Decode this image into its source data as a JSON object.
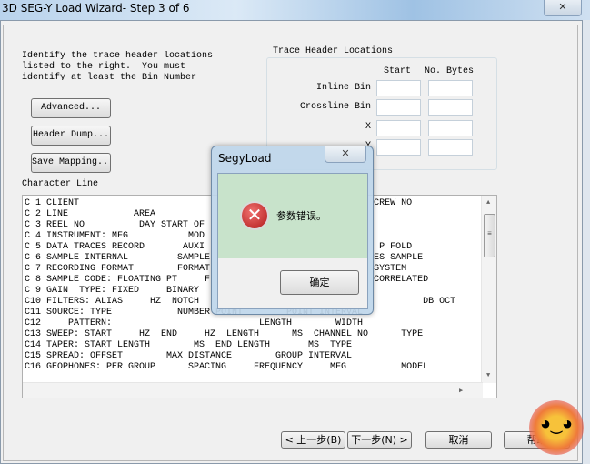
{
  "window": {
    "title": "3D SEG-Y Load Wizard- Step 3 of 6",
    "close_glyph": "✕"
  },
  "instructions": "Identify the trace header locations\nlisted to the right.  You must\nidentify at least the Bin Number\nfields.",
  "buttons": {
    "advanced": "Advanced...",
    "header_dump": "Header Dump...",
    "save_mapping": "Save Mapping..."
  },
  "trace_header": {
    "title": "Trace Header Locations",
    "col_start": "Start",
    "col_bytes": "No. Bytes",
    "rows": [
      {
        "label": "Inline Bin",
        "start": "",
        "bytes": ""
      },
      {
        "label": "Crossline Bin",
        "start": "",
        "bytes": ""
      },
      {
        "label": "X",
        "start": "",
        "bytes": ""
      },
      {
        "label": "Y",
        "start": "",
        "bytes": ""
      }
    ]
  },
  "character_line": {
    "label": "Character Line",
    "lines": [
      "C 1 CLIENT                                                      CREW NO",
      "C 2 LINE            AREA",
      "C 3 REEL NO          DAY START OF",
      "C 4 INSTRUMENT: MFG           MOD",
      "C 5 DATA TRACES RECORD       AUXI                                P FOLD",
      "C 6 SAMPLE INTERNAL         SAMPLE                              ES SAMPLE",
      "C 7 RECORDING FORMAT        FORMAT                              SYSTEM",
      "C 8 SAMPLE CODE: FLOATING PT     F                              CORRELATED",
      "C 9 GAIN  TYPE: FIXED     BINARY",
      "C10 FILTERS: ALIAS     HZ  NOTCH                                         DB OCT",
      "C11 SOURCE: TYPE            NUMBER POINT        POINT INTERVAL",
      "C12     PATTERN:                           LENGTH        WIDTH",
      "C13 SWEEP: START     HZ  END     HZ  LENGTH      MS  CHANNEL NO      TYPE",
      "C14 TAPER: START LENGTH        MS  END LENGTH       MS  TYPE",
      "C15 SPREAD: OFFSET        MAX DISTANCE        GROUP INTERVAL",
      "C16 GEOPHONES: PER GROUP      SPACING     FREQUENCY     MFG          MODEL"
    ]
  },
  "footer": {
    "back": "< 上一步(B)",
    "next": "下一步(N) >",
    "cancel": "取消",
    "help": "帮助"
  },
  "dialog": {
    "title": "SegyLoad",
    "message": "参数错误。",
    "ok": "确定",
    "icon": "error-icon",
    "close_glyph": "✕"
  }
}
